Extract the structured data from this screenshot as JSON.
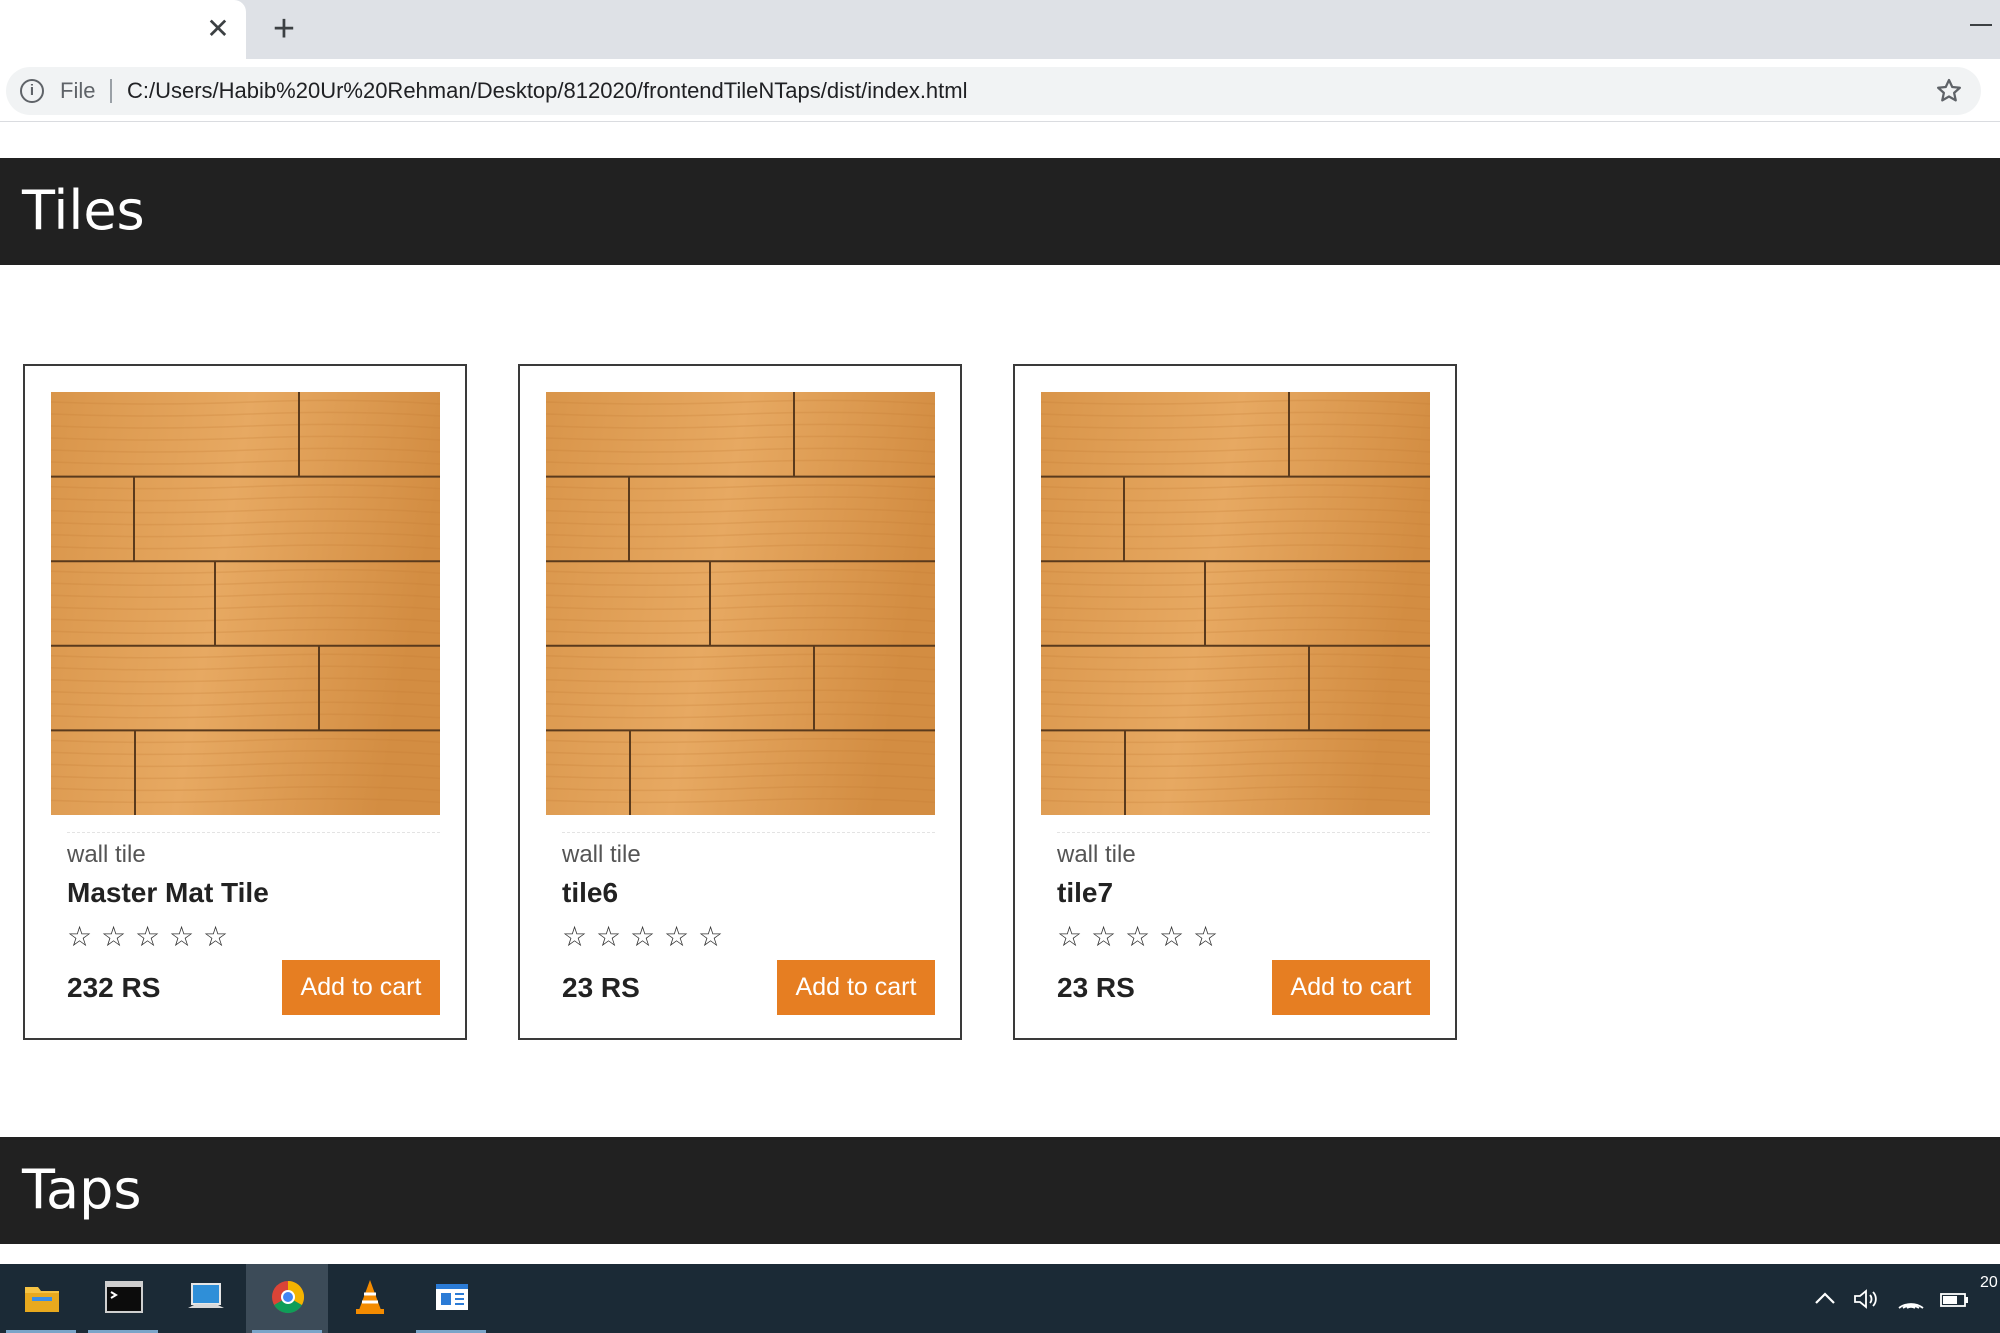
{
  "browser": {
    "tab_close_glyph": "✕",
    "new_tab_glyph": "+",
    "url_scheme": "File",
    "url": "C:/Users/Habib%20Ur%20Rehman/Desktop/812020/frontendTileNTaps/dist/index.html",
    "info_glyph": "i"
  },
  "sections": {
    "tiles_title": "Tiles",
    "taps_title": "Taps"
  },
  "products": [
    {
      "category": "wall tile",
      "name": "Master Mat Tile",
      "rating": 0,
      "max_rating": 5,
      "price": "232 RS",
      "button": "Add to cart"
    },
    {
      "category": "wall tile",
      "name": "tile6",
      "rating": 0,
      "max_rating": 5,
      "price": "23 RS",
      "button": "Add to cart"
    },
    {
      "category": "wall tile",
      "name": "tile7",
      "rating": 0,
      "max_rating": 5,
      "price": "23 RS",
      "button": "Add to cart"
    }
  ],
  "star_glyph": "☆",
  "colors": {
    "header_bg": "#212121",
    "button_bg": "#e67e22",
    "taskbar_bg": "#1b2a36"
  },
  "taskbar": {
    "apps": [
      "file-explorer-icon",
      "command-prompt-icon",
      "remote-desktop-icon",
      "chrome-icon",
      "vlc-icon",
      "app-window-icon"
    ],
    "active_app": "chrome-icon",
    "clock_fragment": "20"
  }
}
